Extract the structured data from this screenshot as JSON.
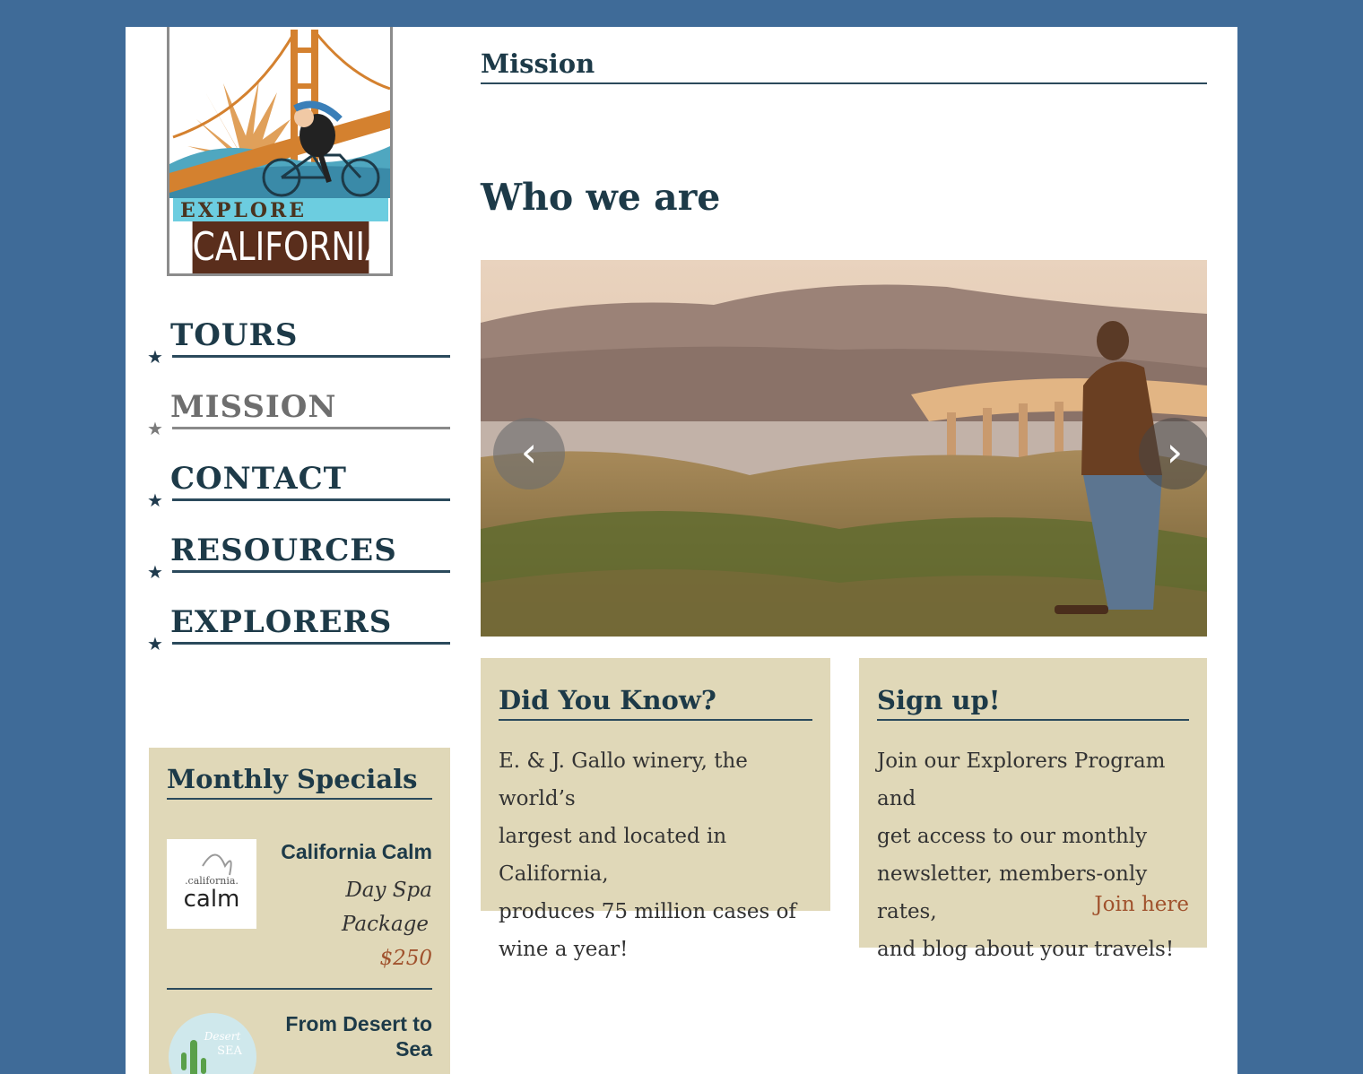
{
  "logo": {
    "line1": "EXPLORE",
    "line2": "CALIFORNIA"
  },
  "nav": {
    "items": [
      {
        "label": "TOURS"
      },
      {
        "label": "MISSION"
      },
      {
        "label": "CONTACT"
      },
      {
        "label": "RESOURCES"
      },
      {
        "label": "EXPLORERS"
      }
    ],
    "active": "MISSION"
  },
  "breadcrumb": "Mission",
  "heading": "Who we are",
  "carousel": {
    "prev_icon": "chevron-left-icon",
    "next_icon": "chevron-right-icon",
    "prev_glyph": "‹",
    "next_glyph": "›"
  },
  "specials": {
    "title": "Monthly Specials",
    "items": [
      {
        "name": "California Calm",
        "desc_line1": "Day Spa",
        "desc_line2": "Package",
        "price": "$250",
        "thumb_small": ".california.",
        "thumb_big": "calm"
      },
      {
        "name_line1": "From Desert to",
        "name_line2": "Sea",
        "thumb_small": "Desert",
        "thumb_big": "SEA"
      }
    ]
  },
  "did_you_know": {
    "title": "Did You Know?",
    "lines": [
      "E. & J. Gallo winery, the world’s",
      "largest and located in California,",
      "produces 75 million cases of",
      "wine a year!"
    ]
  },
  "sign_up": {
    "title": "Sign up!",
    "lines": [
      "Join our Explorers Program and",
      "get access to our monthly",
      "newsletter, members-only rates,",
      "and blog about your travels!"
    ],
    "link": "Join here"
  },
  "colors": {
    "background": "#3f6b98",
    "heading": "#1d3a48",
    "panel": "#e0d8b8",
    "link": "#a0522d"
  }
}
